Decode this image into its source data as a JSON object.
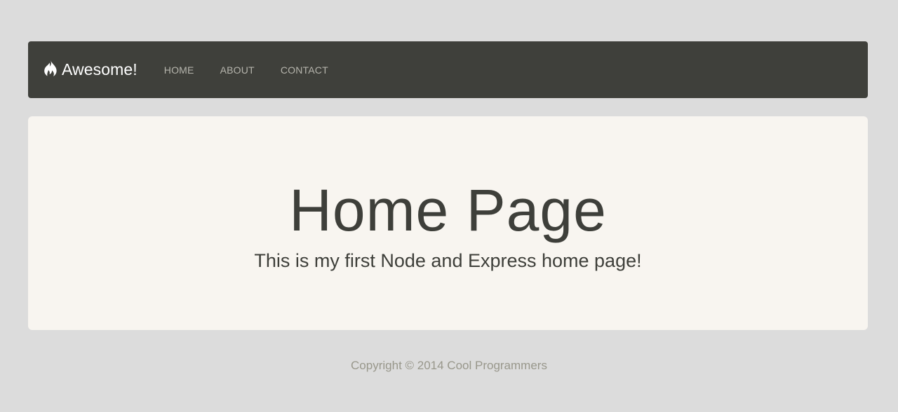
{
  "navbar": {
    "brand_icon": "fire-icon",
    "brand": "Awesome!",
    "items": [
      {
        "label": "HOME"
      },
      {
        "label": "ABOUT"
      },
      {
        "label": "CONTACT"
      }
    ]
  },
  "jumbotron": {
    "title": "Home Page",
    "lead": "This is my first Node and Express home page!"
  },
  "footer": {
    "copyright": "Copyright © 2014 Cool Programmers"
  },
  "colors": {
    "page_background": "#dcdcdc",
    "navbar_background": "#3f403b",
    "nav_link": "#b6b5ad",
    "jumbotron_background": "#f8f5f0",
    "text": "#3e3f3a",
    "footer_text": "#98978b"
  }
}
